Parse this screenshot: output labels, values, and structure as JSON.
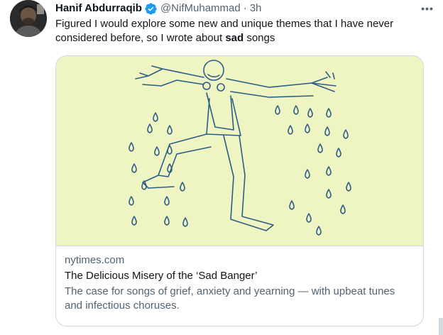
{
  "tweet": {
    "display_name": "Hanif Abdurraqib",
    "handle": "@NifMuhammad",
    "separator": "·",
    "time": "3h",
    "more_label": "•••",
    "text_before": "Figured I would explore some new and unique themes that I have never considered before, so I wrote about ",
    "text_bold": "sad",
    "text_after": " songs"
  },
  "card": {
    "domain": "nytimes.com",
    "title": "The Delicious Misery of the ‘Sad Banger’",
    "description": "The case for songs of grief, anxiety and yearning — with upbeat tunes and infectious choruses."
  },
  "colors": {
    "illustration_bg": "#eef5c2",
    "illustration_line": "#2d5d86",
    "verified_blue": "#1d9bf0",
    "secondary_text": "#536471"
  },
  "icons": {
    "verified": "verified-badge-icon",
    "more": "more-options-icon"
  }
}
